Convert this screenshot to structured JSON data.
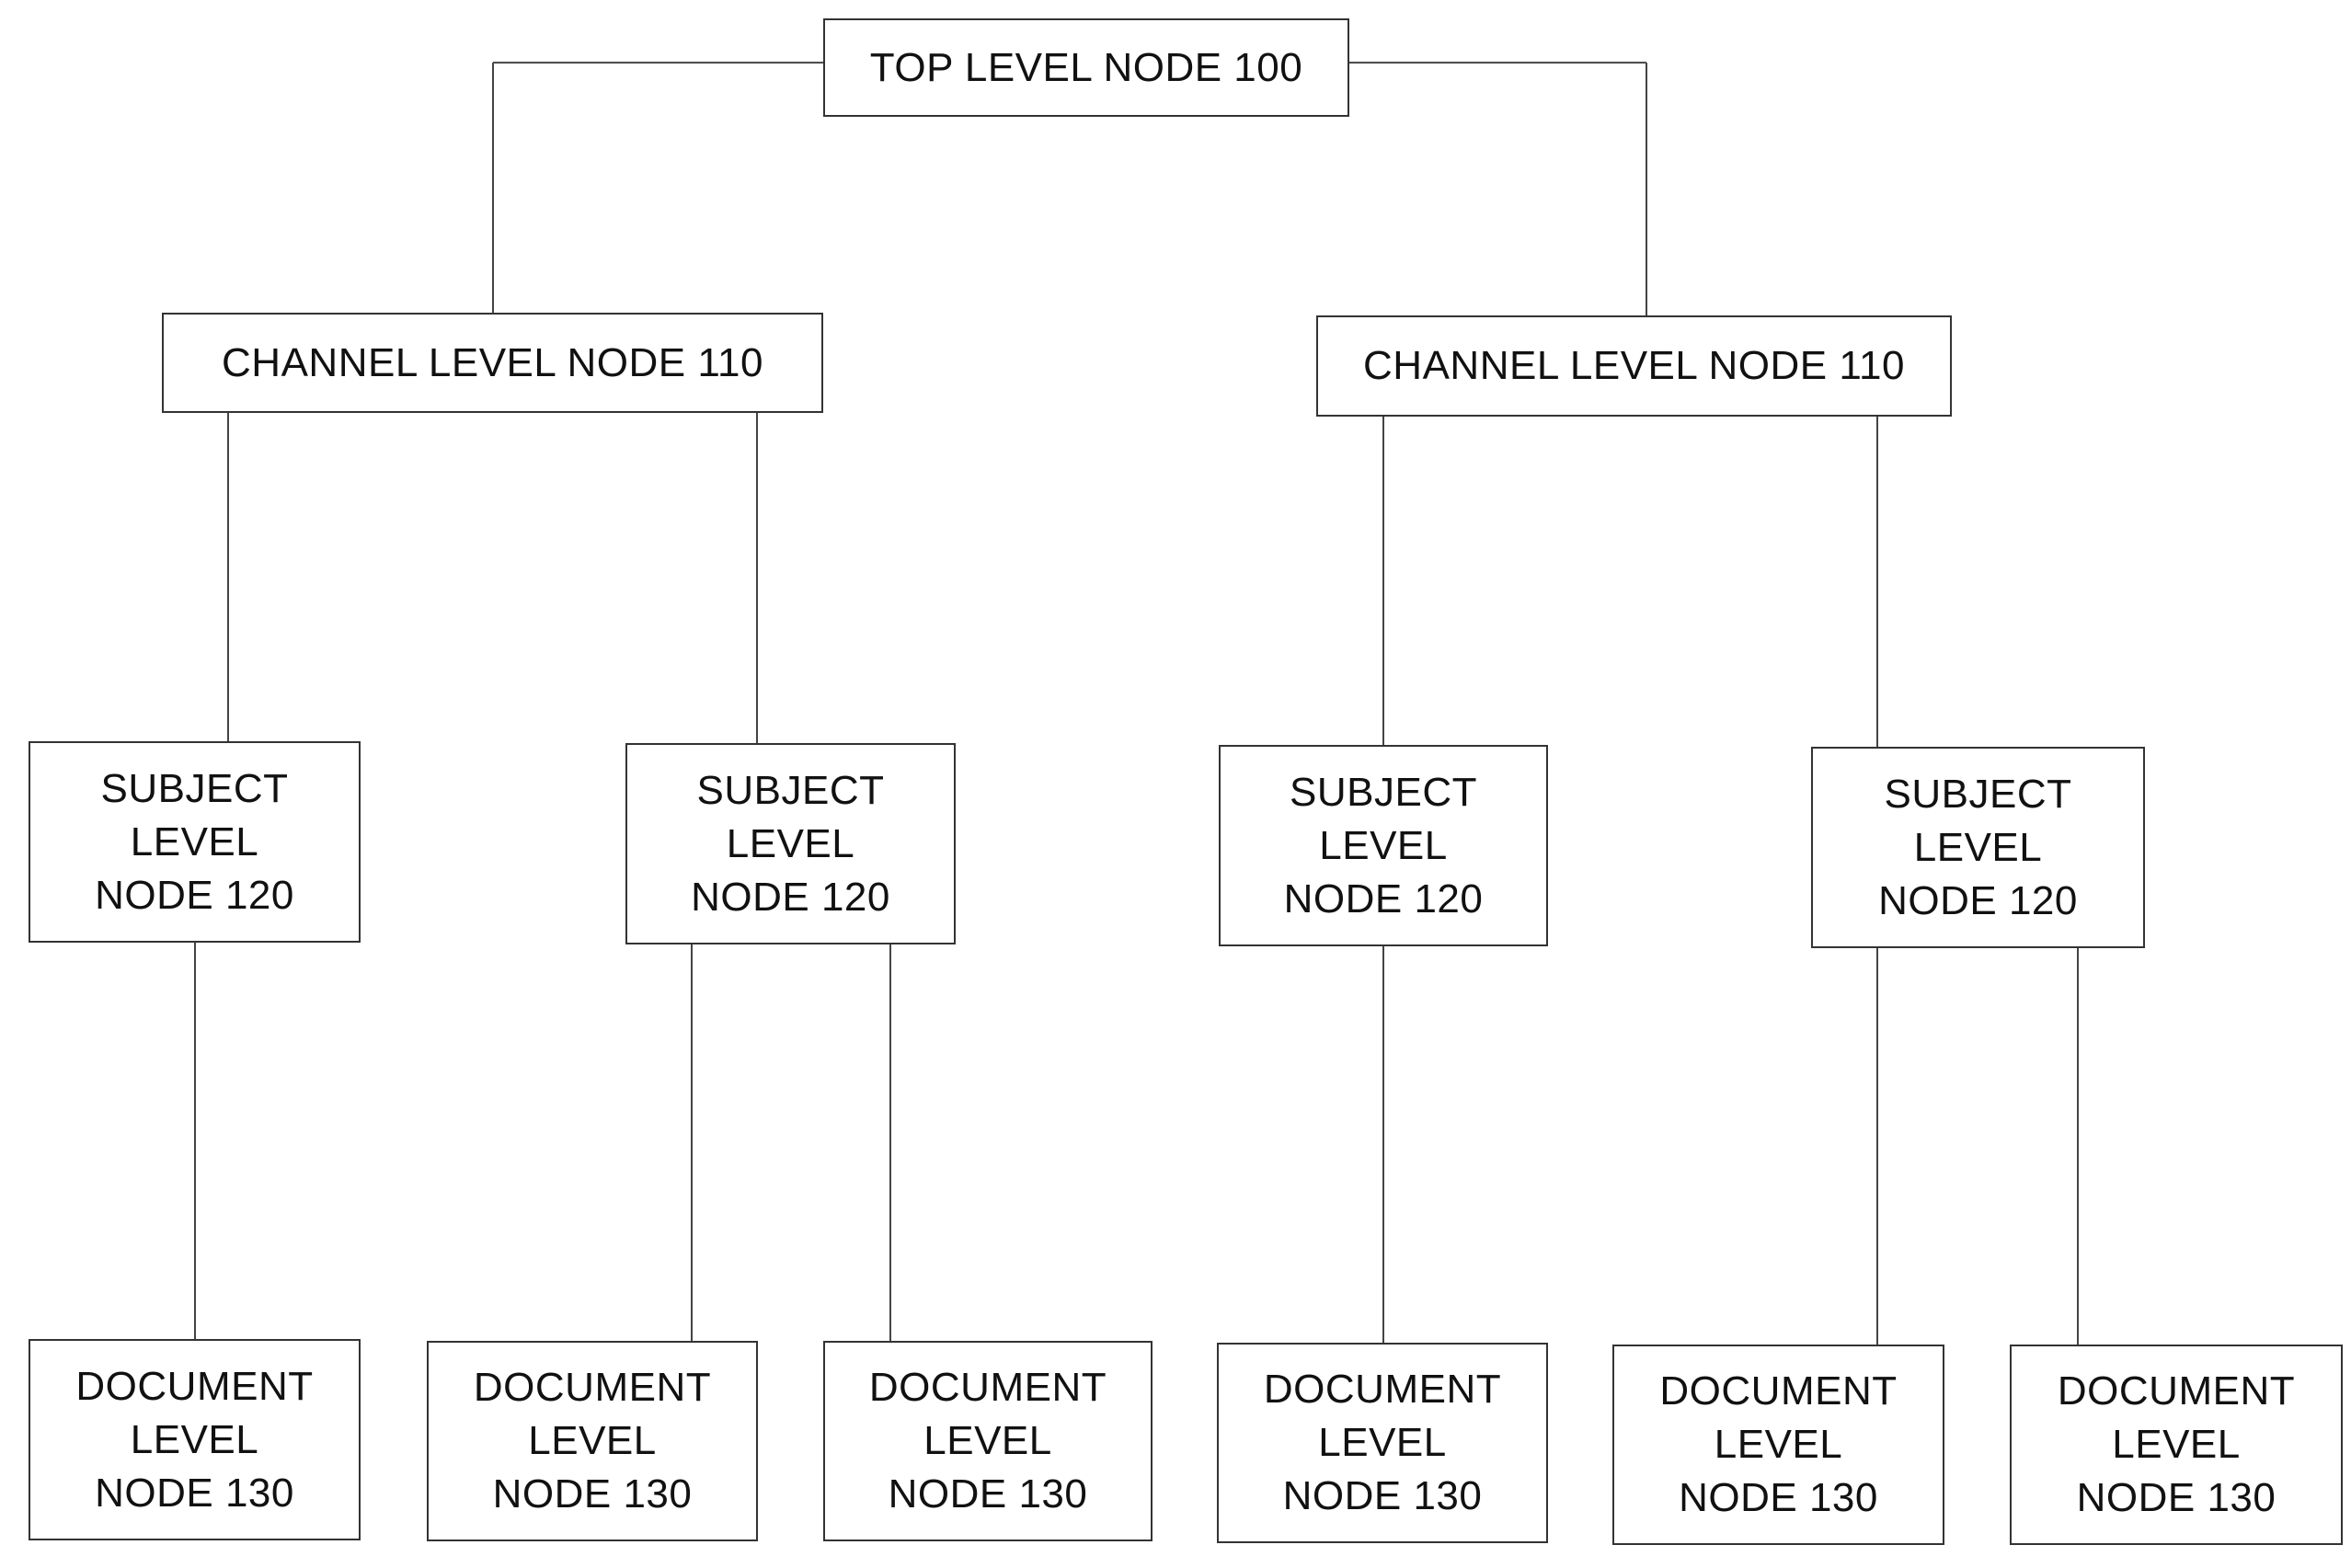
{
  "diagram": {
    "type": "tree",
    "nodes": [
      {
        "id": "top",
        "level": "top",
        "lines": [
          "TOP LEVEL NODE 100"
        ]
      },
      {
        "id": "ch1",
        "level": "channel",
        "parent": "top",
        "lines": [
          "CHANNEL LEVEL NODE 110"
        ]
      },
      {
        "id": "ch2",
        "level": "channel",
        "parent": "top",
        "lines": [
          "CHANNEL LEVEL NODE 110"
        ]
      },
      {
        "id": "s1",
        "level": "subject",
        "parent": "ch1",
        "lines": [
          "SUBJECT",
          "LEVEL",
          "NODE 120"
        ]
      },
      {
        "id": "s2",
        "level": "subject",
        "parent": "ch1",
        "lines": [
          "SUBJECT",
          "LEVEL",
          "NODE 120"
        ]
      },
      {
        "id": "s3",
        "level": "subject",
        "parent": "ch2",
        "lines": [
          "SUBJECT",
          "LEVEL",
          "NODE 120"
        ]
      },
      {
        "id": "s4",
        "level": "subject",
        "parent": "ch2",
        "lines": [
          "SUBJECT",
          "LEVEL",
          "NODE 120"
        ]
      },
      {
        "id": "d1",
        "level": "document",
        "parent": "s1",
        "lines": [
          "DOCUMENT",
          "LEVEL",
          "NODE 130"
        ]
      },
      {
        "id": "d2",
        "level": "document",
        "parent": "s2",
        "lines": [
          "DOCUMENT",
          "LEVEL",
          "NODE 130"
        ]
      },
      {
        "id": "d3",
        "level": "document",
        "parent": "s2",
        "lines": [
          "DOCUMENT",
          "LEVEL",
          "NODE 130"
        ]
      },
      {
        "id": "d4",
        "level": "document",
        "parent": "s3",
        "lines": [
          "DOCUMENT",
          "LEVEL",
          "NODE 130"
        ]
      },
      {
        "id": "d5",
        "level": "document",
        "parent": "s4",
        "lines": [
          "DOCUMENT",
          "LEVEL",
          "NODE 130"
        ]
      },
      {
        "id": "d6",
        "level": "document",
        "parent": "s4",
        "lines": [
          "DOCUMENT",
          "LEVEL",
          "NODE 130"
        ]
      }
    ]
  }
}
